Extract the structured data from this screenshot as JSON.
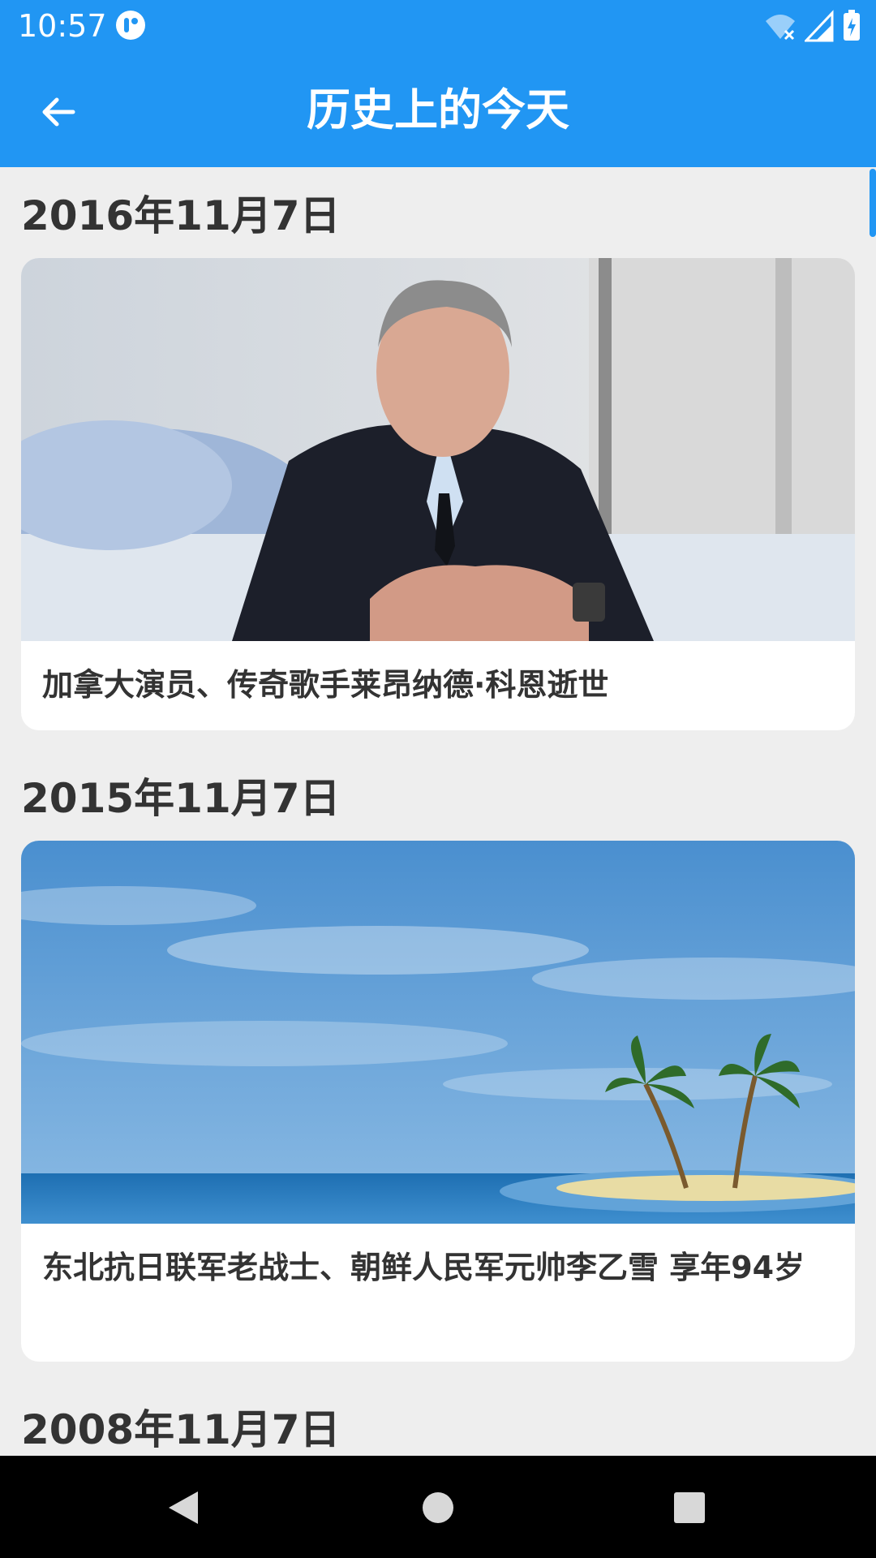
{
  "status_bar": {
    "time": "10:57",
    "icons": [
      "app-notification-icon",
      "wifi-icon",
      "signal-icon",
      "battery-charging-icon"
    ],
    "background": "#2196f3"
  },
  "app_bar": {
    "title": "历史上的今天",
    "back_icon": "arrow-left-icon",
    "background": "#2196f3"
  },
  "entries": [
    {
      "date": "2016年11月7日",
      "image": "portrait-photo",
      "text": "加拿大演员、传奇歌手莱昂纳德·科恩逝世"
    },
    {
      "date": "2015年11月7日",
      "image": "island-sky-illustration",
      "text": "东北抗日联军老战士、朝鲜人民军元帅李乙雪  享年94岁"
    },
    {
      "date": "2008年11月7日"
    }
  ],
  "nav_bar": {
    "buttons": [
      "back-triangle-icon",
      "home-circle-icon",
      "recents-square-icon"
    ]
  }
}
